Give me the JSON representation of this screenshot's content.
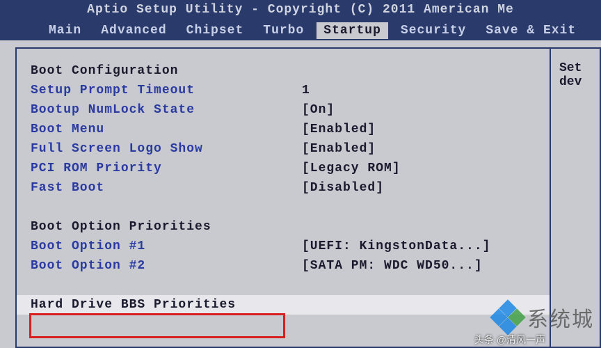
{
  "title": "Aptio Setup Utility - Copyright (C) 2011 American Me",
  "tabs": {
    "main": "Main",
    "advanced": "Advanced",
    "chipset": "Chipset",
    "turbo": "Turbo",
    "startup": "Startup",
    "security": "Security",
    "saveexit": "Save & Exit"
  },
  "section1_heading": "Boot Configuration",
  "items": {
    "setup_prompt_timeout": {
      "label": "Setup Prompt Timeout",
      "value": "1"
    },
    "bootup_numlock": {
      "label": "Bootup NumLock State",
      "value": "[On]"
    },
    "boot_menu": {
      "label": "Boot Menu",
      "value": "[Enabled]"
    },
    "full_screen_logo": {
      "label": "Full Screen Logo Show",
      "value": "[Enabled]"
    },
    "pci_rom_priority": {
      "label": "PCI ROM Priority",
      "value": "[Legacy ROM]"
    },
    "fast_boot": {
      "label": "Fast Boot",
      "value": "[Disabled]"
    }
  },
  "section2_heading": "Boot Option Priorities",
  "boot_options": {
    "opt1": {
      "label": "Boot Option #1",
      "value": "[UEFI: KingstonData...]"
    },
    "opt2": {
      "label": "Boot Option #2",
      "value": "[SATA  PM: WDC WD50...]"
    }
  },
  "selected_item": "Hard Drive BBS Priorities",
  "help_panel": {
    "line1": "Set",
    "line2": "dev"
  },
  "watermark_text": "系统城",
  "credit_text": "头条 @清风一声"
}
